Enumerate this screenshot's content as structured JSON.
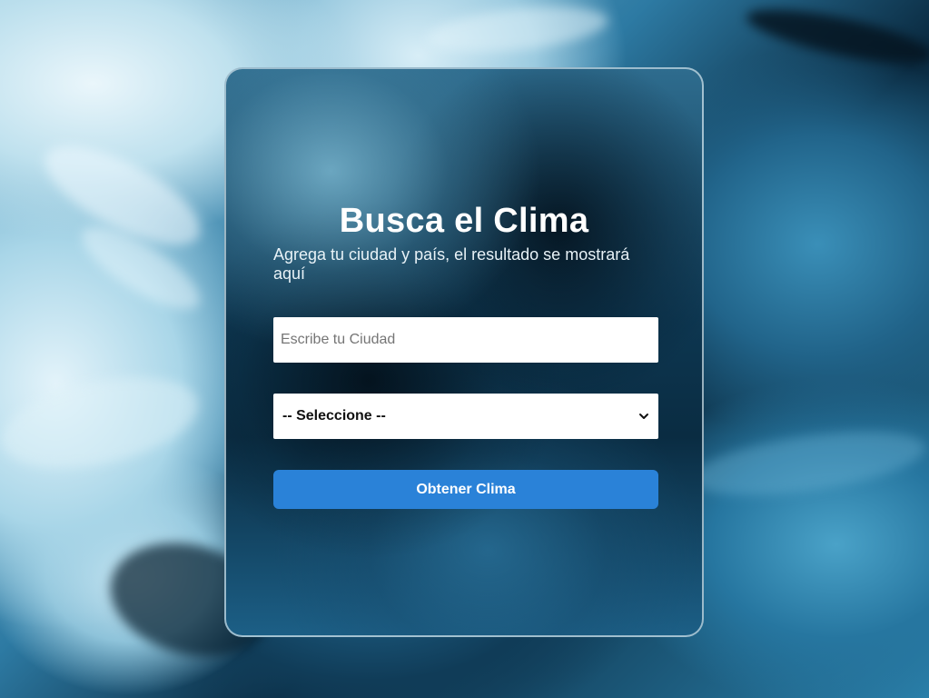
{
  "page": {
    "title": "Busca el Clima",
    "subtitle": "Agrega tu ciudad y país, el resultado se mostrará aquí"
  },
  "form": {
    "city_input": {
      "placeholder": "Escribe tu Ciudad",
      "value": ""
    },
    "country_select": {
      "selected": "-- Seleccione --"
    },
    "submit_label": "Obtener Clima"
  },
  "icons": {
    "select_arrow": "chevron-down-icon"
  },
  "colors": {
    "button_bg": "#2a82d8",
    "title_text": "#ffffff",
    "input_bg": "#ffffff"
  }
}
